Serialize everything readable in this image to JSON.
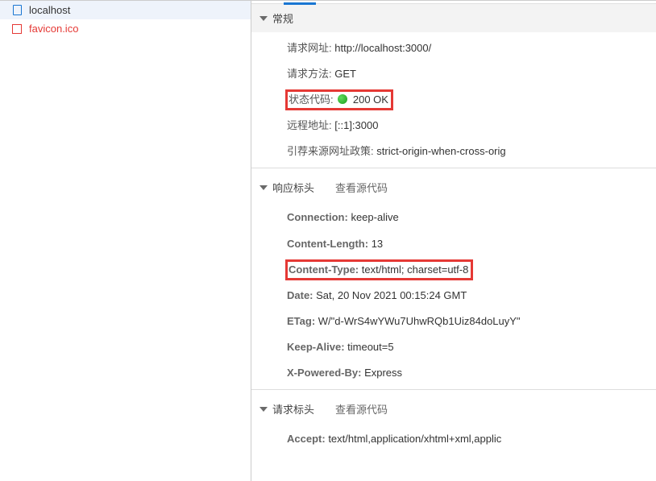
{
  "sidebar": {
    "items": [
      {
        "label": "localhost",
        "kind": "document",
        "selected": true,
        "textClass": "lbl-localhost"
      },
      {
        "label": "favicon.ico",
        "kind": "missing",
        "selected": false,
        "textClass": "lbl-favicon"
      }
    ]
  },
  "general": {
    "title": "常规",
    "url_label": "请求网址:",
    "url_value": "http://localhost:3000/",
    "method_label": "请求方法:",
    "method_value": "GET",
    "status_label": "状态代码:",
    "status_value": "200 OK",
    "remote_label": "远程地址:",
    "remote_value": "[::1]:3000",
    "referrer_label": "引荐来源网址政策:",
    "referrer_value": "strict-origin-when-cross-orig"
  },
  "response": {
    "title": "响应标头",
    "view_source": "查看源代码",
    "headers": [
      {
        "name": "Connection:",
        "value": "keep-alive"
      },
      {
        "name": "Content-Length:",
        "value": "13"
      },
      {
        "name": "Content-Type:",
        "value": "text/html; charset=utf-8",
        "highlight": true
      },
      {
        "name": "Date:",
        "value": "Sat, 20 Nov 2021 00:15:24 GMT"
      },
      {
        "name": "ETag:",
        "value": "W/\"d-WrS4wYWu7UhwRQb1Uiz84doLuyY\""
      },
      {
        "name": "Keep-Alive:",
        "value": "timeout=5"
      },
      {
        "name": "X-Powered-By:",
        "value": "Express"
      }
    ]
  },
  "request": {
    "title": "请求标头",
    "view_source": "查看源代码",
    "accept_label": "Accept:",
    "accept_value": "text/html,application/xhtml+xml,applic"
  }
}
